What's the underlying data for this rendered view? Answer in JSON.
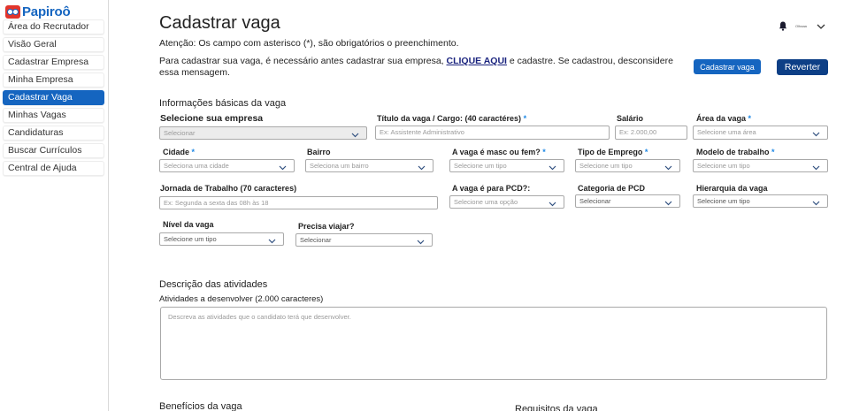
{
  "brand": {
    "name": "Papiroô",
    "logo_color": "#e2352c",
    "accent": "#1565c0"
  },
  "sidebar": {
    "items": [
      {
        "label": "Área do Recrutador",
        "active": false
      },
      {
        "label": "Visão Geral",
        "active": false
      },
      {
        "label": "Cadastrar Empresa",
        "active": false
      },
      {
        "label": "Minha Empresa",
        "active": false
      },
      {
        "label": "Cadastrar Vaga",
        "active": true
      },
      {
        "label": "Minhas Vagas",
        "active": false
      },
      {
        "label": "Candidaturas",
        "active": false
      },
      {
        "label": "Buscar Currículos",
        "active": false
      },
      {
        "label": "Central de Ajuda",
        "active": false
      }
    ]
  },
  "header": {
    "user_label": "Olhaaa",
    "bell_icon": "bell-icon",
    "menu_icon": "chevron-down-icon"
  },
  "main": {
    "title": "Cadastrar vaga",
    "notice": "Atenção: Os campo com asterisco (*), são obrigatórios o preenchimento.",
    "info_before": "Para cadastrar sua vaga, é necessário antes cadastrar sua empresa, ",
    "info_link": "CLIQUE AQUI",
    "info_after": " e cadastre. Se cadastrou, desconsidere essa mensagem.",
    "btn_cadastrar": "Cadastrar vaga",
    "btn_reverter": "Reverter",
    "section_basic": "Informações básicas da vaga",
    "section_desc": "Descrição das atividades",
    "section_benef": "Benefícios da vaga",
    "section_req": "Requisitos da vaga"
  },
  "form": {
    "empresa": {
      "label": "Selecione sua empresa",
      "value": "Selecionar"
    },
    "titulo": {
      "label": "Título da vaga / Cargo: (40 caractéres)",
      "required": "*",
      "placeholder": "Ex: Assistente Administrativo"
    },
    "salario": {
      "label": "Salário",
      "placeholder": "Ex: 2.000,00"
    },
    "area": {
      "label": "Área da vaga",
      "required": "*",
      "placeholder": "Selecione uma área"
    },
    "cidade": {
      "label": "Cidade",
      "required": "*",
      "placeholder": "Seleciona uma cidade"
    },
    "bairro": {
      "label": "Bairro",
      "placeholder": "Seleciona um bairro"
    },
    "sexo": {
      "label": "A vaga é masc ou fem?",
      "required": "*",
      "placeholder": "Selecione um tipo"
    },
    "tipo_emprego": {
      "label": "Tipo de Emprego",
      "required": "*",
      "placeholder": "Selecione um tipo"
    },
    "modelo": {
      "label": "Modelo de trabalho",
      "required": "*",
      "placeholder": "Selecione um tipo"
    },
    "jornada": {
      "label": "Jornada de Trabalho (70 caracteres)",
      "placeholder": "Ex: Segunda a sexta das 08h às 18"
    },
    "pcd": {
      "label": "A vaga é para PCD?:",
      "placeholder": "Selecione uma opção"
    },
    "categoria_pcd": {
      "label": "Categoria de PCD",
      "value": "Selecionar"
    },
    "hierarquia": {
      "label": "Hierarquia da vaga",
      "placeholder": "Selecione um tipo"
    },
    "nivel": {
      "label": "Nível da vaga",
      "placeholder": "Selecione um tipo"
    },
    "viajar": {
      "label": "Precisa viajar?",
      "value": "Selecionar"
    },
    "atividades": {
      "label": "Atividades a desenvolver (2.000 caracteres)",
      "placeholder": "Descreva as atividades que o candidato terá que desenvolver."
    }
  }
}
